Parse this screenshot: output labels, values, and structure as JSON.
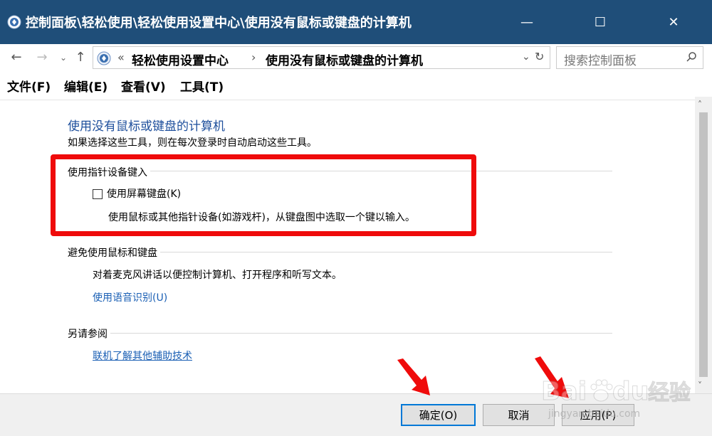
{
  "window": {
    "title": "控制面板\\轻松使用\\轻松使用设置中心\\使用没有鼠标或键盘的计算机",
    "min_glyph": "—",
    "max_glyph": "☐",
    "close_glyph": "✕"
  },
  "address_bar": {
    "back_glyph": "←",
    "forward_glyph": "→",
    "recent_glyph": "⌄",
    "up_glyph": "↑",
    "sep_glyph": "«",
    "crumb_sep_glyph": "›",
    "crumbs": [
      "轻松使用设置中心",
      "使用没有鼠标或键盘的计算机"
    ],
    "dropdown_glyph": "⌄",
    "refresh_glyph": "↻",
    "search_placeholder": "搜索控制面板"
  },
  "menu": {
    "items": [
      "文件(F)",
      "编辑(E)",
      "查看(V)",
      "工具(T)"
    ]
  },
  "content": {
    "heading": "使用没有鼠标或键盘的计算机",
    "subtext": "如果选择这些工具，则在每次登录时自动启动这些工具。",
    "section1": {
      "title": "使用指针设备键入",
      "checkbox_label": "使用屏幕键盘(K)",
      "checked": false,
      "description": "使用鼠标或其他指针设备(如游戏杆)，从键盘图中选取一个键以输入。"
    },
    "section2": {
      "title": "避免使用鼠标和键盘",
      "description": "对着麦克风讲话以便控制计算机、打开程序和听写文本。",
      "link": "使用语音识别(U)"
    },
    "section3": {
      "title": "另请参阅",
      "link": "联机了解其他辅助技术"
    }
  },
  "scrollbar": {
    "up_glyph": "˄",
    "down_glyph": "˅"
  },
  "buttons": {
    "ok": "确定(O)",
    "cancel": "取消",
    "apply": "应用(P)"
  },
  "watermark": {
    "brand": "Bai",
    "brand2": "du",
    "suffix": "经验",
    "url": "jingyan.baidu.com"
  },
  "colors": {
    "titlebar": "#1f4e79",
    "highlight": "#ef0b0b",
    "link": "#1a5fb4",
    "heading": "#1e4f9c"
  }
}
